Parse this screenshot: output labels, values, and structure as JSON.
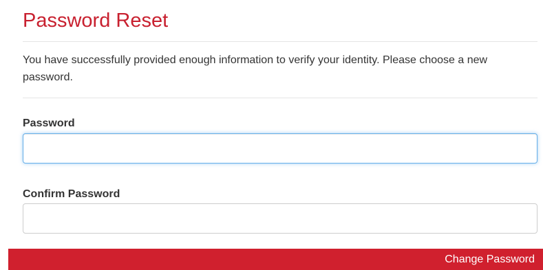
{
  "page": {
    "title": "Password Reset",
    "intro": "You have successfully provided enough information to verify your identity. Please choose a new password."
  },
  "form": {
    "password_label": "Password",
    "password_value": "",
    "confirm_label": "Confirm Password",
    "confirm_value": "",
    "submit_label": "Change Password"
  },
  "colors": {
    "brand_red": "#c8202f",
    "button_red": "#d0202e",
    "focus_blue": "#66afe9",
    "text": "#333333",
    "divider": "#e5e5e5"
  }
}
